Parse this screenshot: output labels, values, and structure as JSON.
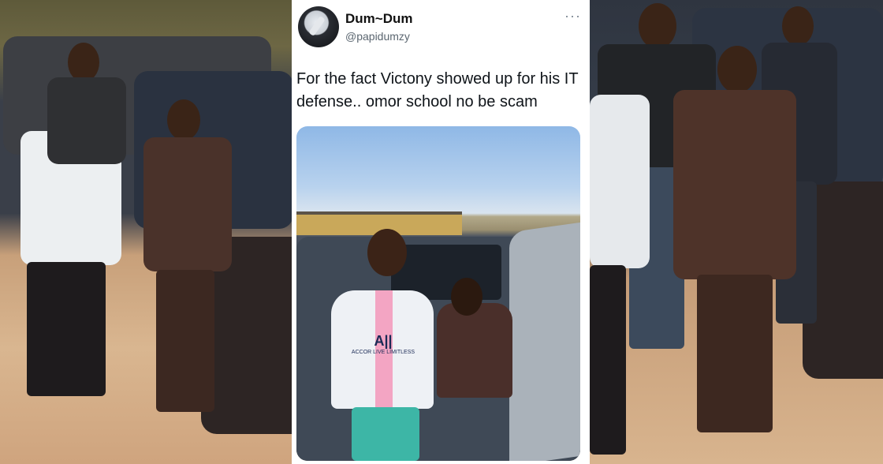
{
  "tweet": {
    "display_name": "Dum~Dum",
    "handle": "@papidumzy",
    "more_icon": "more-icon",
    "text": "For the fact Victony showed up for his IT defense.. omor school no be scam"
  },
  "photo": {
    "shirt_logo": "A||",
    "shirt_sponsor": "ACCOR LIVE LIMITLESS"
  },
  "colors": {
    "name": "#111111",
    "handle": "#5b6670",
    "text": "#0f1419",
    "shirt_stripe": "#f3a5c3",
    "pants": "#3db6a6"
  }
}
